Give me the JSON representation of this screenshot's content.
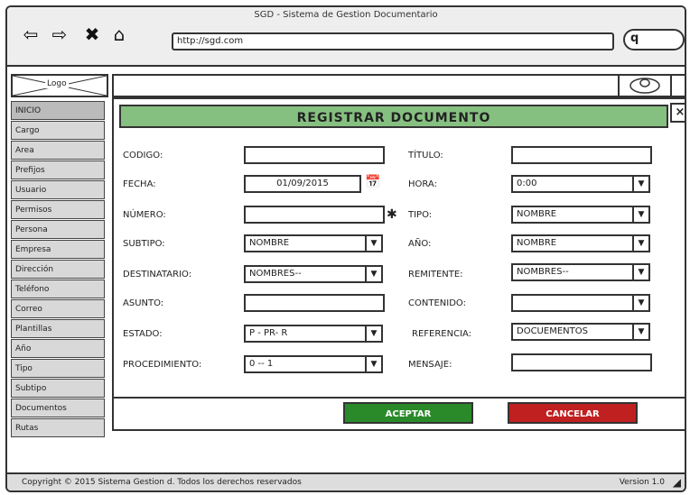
{
  "window": {
    "title": "SGD - Sistema de Gestion Documentario"
  },
  "browser": {
    "url": "http://sgd.com",
    "search_glyph": "q"
  },
  "header": {
    "logo_label": "Logo"
  },
  "sidebar": {
    "items": [
      "INICIO",
      "Cargo",
      "Area",
      "Prefijos",
      "Usuario",
      "Permisos",
      "Persona",
      "Empresa",
      "Dirección",
      "Teléfono",
      "Correo",
      "Plantillas",
      "Año",
      "Tipo",
      "Subtipo",
      "Documentos",
      "Rutas"
    ]
  },
  "modal": {
    "title": "REGISTRAR DOCUMENTO",
    "close_label": "×",
    "fields": {
      "codigo_label": "CODIGO:",
      "codigo_value": "",
      "titulo_label": "TÍTULO:",
      "titulo_value": "",
      "fecha_label": "FECHA:",
      "fecha_value": "01/09/2015",
      "hora_label": "HORA:",
      "hora_value": "0:00",
      "numero_label": "NÚMERO:",
      "numero_value": "",
      "tipo_label": "TIPO:",
      "tipo_value": "NOMBRE",
      "subtipo_label": "SUBTIPO:",
      "subtipo_value": "NOMBRE",
      "anio_label": "AÑO:",
      "anio_value": "NOMBRE",
      "destinatario_label": "DESTINATARIO:",
      "destinatario_value": "NOMBRES--",
      "remitente_label": "REMITENTE:",
      "remitente_value": "NOMBRES--",
      "asunto_label": "ASUNTO:",
      "asunto_value": "",
      "contenido_label": "CONTENIDO:",
      "contenido_value": "",
      "estado_label": "ESTADO:",
      "estado_value": "P - PR- R",
      "referencia_label": "REFERENCIA:",
      "referencia_value": "DOCUEMENTOS",
      "procedimiento_label": "PROCEDIMIENTO:",
      "procedimiento_value": "0 -- 1",
      "mensaje_label": "MENSAJE:",
      "mensaje_value": ""
    },
    "required_mark": "✱",
    "accept_label": "ACEPTAR",
    "cancel_label": "CANCELAR"
  },
  "footer": {
    "copyright": "Copyright © 2015 Sistema Gestion d. Todos los derechos reservados",
    "version": "Version 1.0"
  },
  "colors": {
    "modal_header": "#86c080",
    "accept": "#2a8a2a",
    "cancel": "#c02020"
  },
  "icons": [
    "back-arrow-icon",
    "forward-arrow-icon",
    "close-x-icon",
    "home-icon",
    "search-icon",
    "calendar-icon",
    "avatar-icon",
    "chevron-down-icon"
  ]
}
